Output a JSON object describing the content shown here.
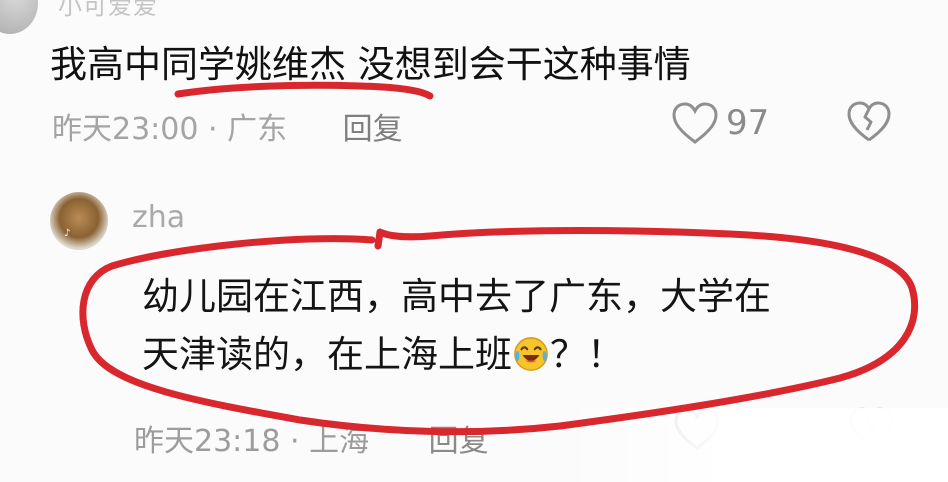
{
  "comment1": {
    "username": "小可爱爱",
    "text": "我高中同学姚维杰 没想到会干这种事情",
    "time": "昨天23:00",
    "separator": "·",
    "location": "广东",
    "reply_label": "回复",
    "like_count": "97",
    "icons": {
      "like": "heart-outline-icon",
      "dislike": "broken-heart-icon"
    }
  },
  "comment2": {
    "username": "zha",
    "text_line1": "幼儿园在江西，高中去了广东，大学在",
    "text_line2": "天津读的，在上海上班",
    "text_tail": "？！",
    "emoji": "laughing-crying-emoji",
    "time": "昨天23:18",
    "separator": "·",
    "location": "上海",
    "reply_label": "回复",
    "icons": {
      "like": "heart-outline-icon",
      "dislike": "broken-heart-icon"
    }
  },
  "annotation_color": "#d9272e"
}
